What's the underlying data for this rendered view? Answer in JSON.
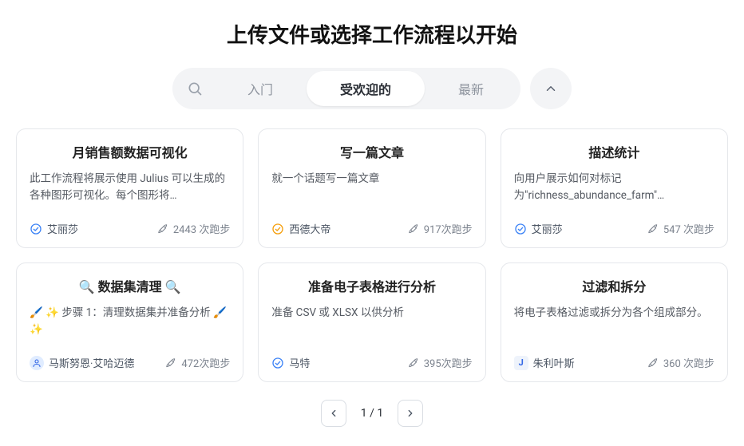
{
  "title": "上传文件或选择工作流程以开始",
  "tabs": {
    "intro": "入门",
    "popular": "受欢迎的",
    "newest": "最新"
  },
  "cards": [
    {
      "title": "月销售额数据可视化",
      "desc": "此工作流程将展示使用 Julius 可以生成的各种图形可视化。每个图形将…",
      "author": "艾丽莎",
      "runs": "2443 次跑步",
      "badge": "verified-blue"
    },
    {
      "title": "写一篇文章",
      "desc": "就一个话题写一篇文章",
      "author": "西德大帝",
      "runs": "917次跑步",
      "badge": "verified-gold"
    },
    {
      "title": "描述统计",
      "desc": "向用户展示如何对标记为\"richness_abundance_farm\"…",
      "author": "艾丽莎",
      "runs": "547 次跑步",
      "badge": "verified-blue"
    },
    {
      "title": "🔍 数据集清理 🔍",
      "desc": "🖌️ ✨ 步骤 1：清理数据集并准备分析 🖌️ ✨",
      "author": "马斯努恩·艾哈迈德",
      "runs": "472次跑步",
      "badge": "avatar-blue"
    },
    {
      "title": "准备电子表格进行分析",
      "desc": "准备 CSV 或 XLSX 以供分析",
      "author": "马特",
      "runs": "395次跑步",
      "badge": "verified-blue"
    },
    {
      "title": "过滤和拆分",
      "desc": "将电子表格过滤或拆分为各个组成部分。",
      "author": "朱利叶斯",
      "runs": "360 次跑步",
      "badge": "avatar-j",
      "initial": "J"
    }
  ],
  "pagination": {
    "label": "1 / 1"
  }
}
